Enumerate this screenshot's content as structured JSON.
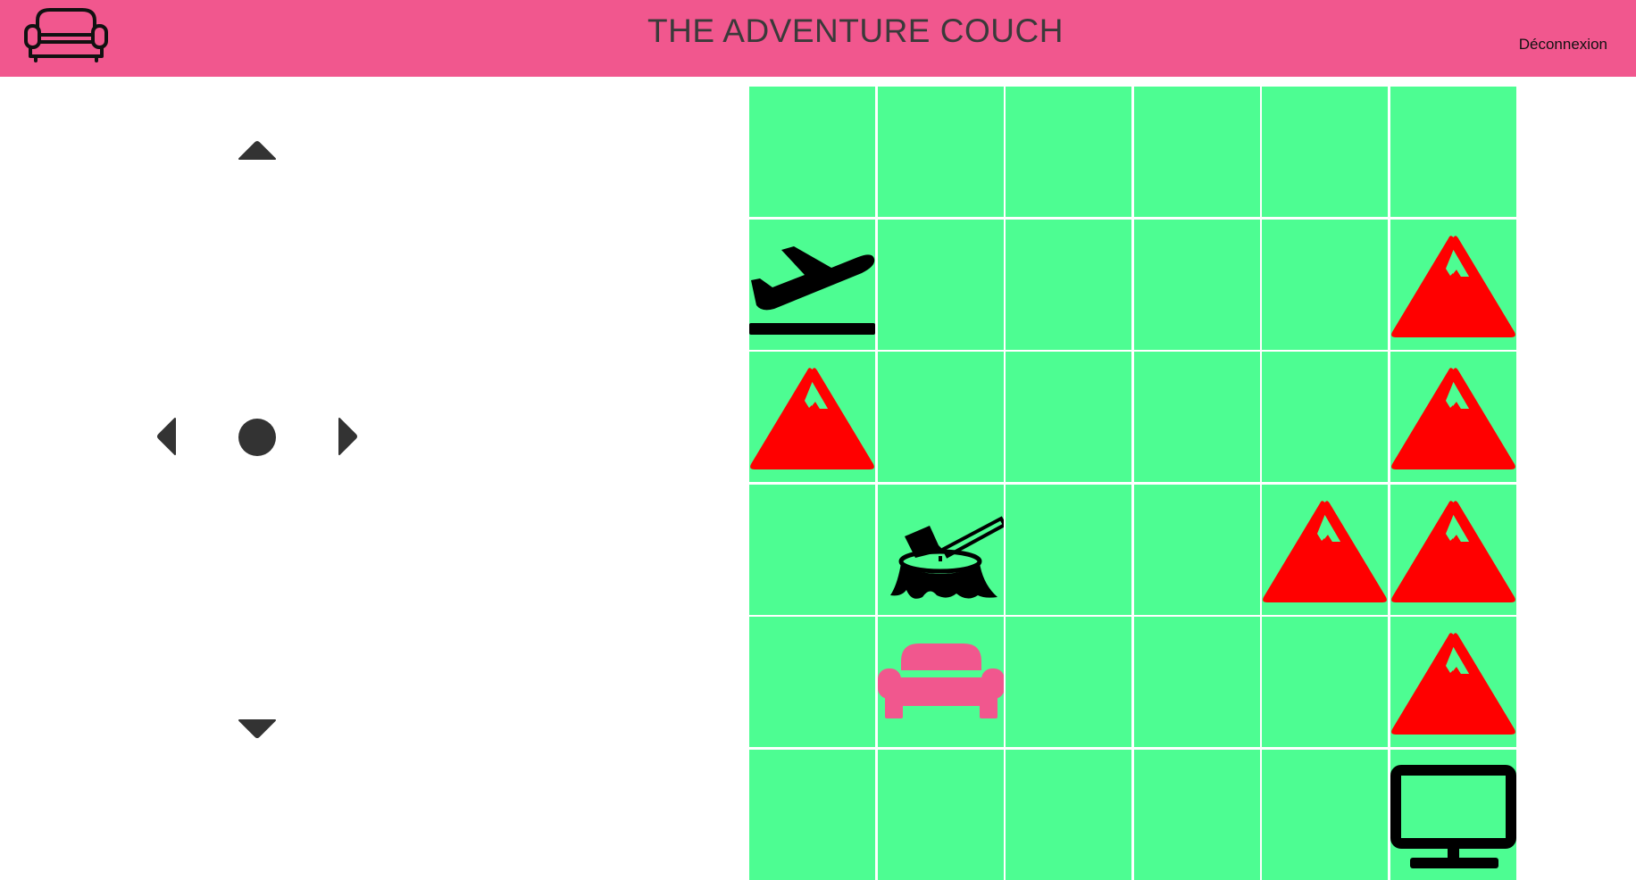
{
  "header": {
    "title": "THE ADVENTURE COUCH",
    "logout_label": "Déconnexion",
    "logo_icon": "couch-outline-icon",
    "background_color": "#f1578e"
  },
  "controls": {
    "color": "#333333",
    "buttons": [
      {
        "name": "move-up",
        "icon": "caret-up-icon"
      },
      {
        "name": "move-left",
        "icon": "caret-left-icon"
      },
      {
        "name": "action-center",
        "icon": "circle-icon"
      },
      {
        "name": "move-right",
        "icon": "caret-right-icon"
      },
      {
        "name": "move-down",
        "icon": "caret-down-icon"
      }
    ]
  },
  "board": {
    "rows": 6,
    "cols": 6,
    "cell_color": "#4dfd92",
    "grid_line_color": "#ffffff",
    "cells": [
      [
        "",
        "",
        "",
        "",
        "",
        ""
      ],
      [
        "airplane",
        "",
        "",
        "",
        "",
        "mountain"
      ],
      [
        "mountain",
        "",
        "",
        "",
        "",
        "mountain"
      ],
      [
        "",
        "stump-axe",
        "",
        "",
        "mountain",
        "mountain"
      ],
      [
        "",
        "couch",
        "",
        "",
        "",
        "mountain"
      ],
      [
        "",
        "",
        "",
        "",
        "",
        "monitor"
      ]
    ],
    "tile_colors": {
      "mountain": "#ff0000",
      "couch": "#f1578e",
      "airplane": "#000000",
      "stump-axe": "#000000",
      "monitor": "#000000"
    }
  }
}
